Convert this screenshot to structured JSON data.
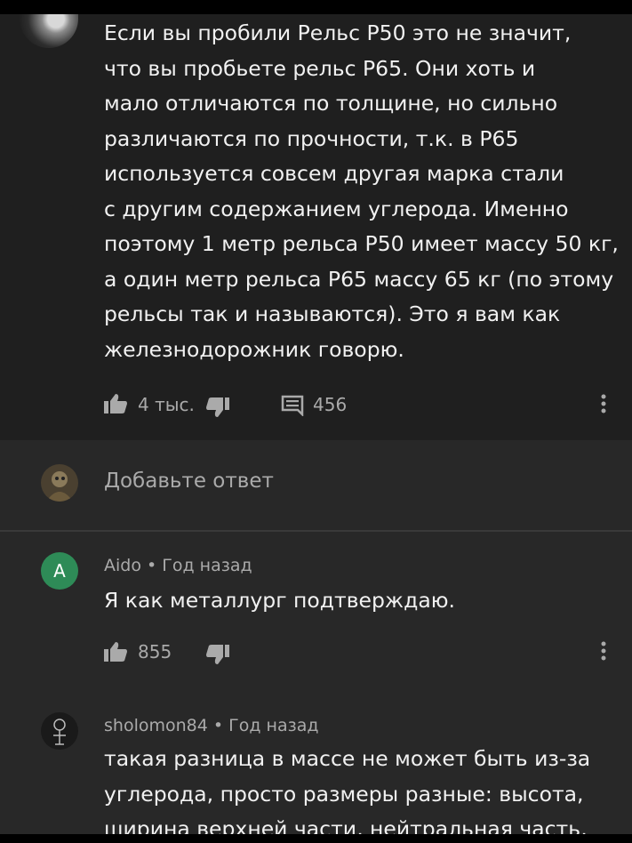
{
  "main_comment": {
    "text": "Если вы пробили Рельс Р50 это не значит,\nчто вы пробьете рельс Р65. Они хоть и\nмало отличаются по толщине, но сильно\nразличаются по прочности, т.к. в Р65\nиспользуется совсем другая марка стали\nс другим содержанием углерода. Именно\nпоэтому 1 метр рельса Р50 имеет массу 50 кг,\nа один метр рельса Р65 массу 65 кг (по этому\nрельсы так и называются). Это я вам как\nжелезнодорожник говорю.",
    "likes": "4 тыс.",
    "replies_count": "456"
  },
  "add_reply": {
    "placeholder": "Добавьте ответ"
  },
  "replies": [
    {
      "avatar_letter": "A",
      "author": "Aido",
      "time": "Год назад",
      "separator": "•",
      "text": "Я как металлург подтверждаю.",
      "likes": "855"
    },
    {
      "author": "sholomon84",
      "time": "Год назад",
      "separator": "•",
      "text": "такая разница в массе не может быть из-за\nуглерода, просто размеры разные: высота,\nширина верхней части, нейтральная часть,"
    }
  ],
  "colors": {
    "background": "#282828",
    "comment_bg": "#1f1f1f",
    "text_primary": "#f1f1f1",
    "text_secondary": "#aaaaaa",
    "avatar_a": "#2e8b57"
  },
  "icons": [
    "thumb-up-icon",
    "thumb-down-icon",
    "comment-icon",
    "more-vert-icon"
  ]
}
